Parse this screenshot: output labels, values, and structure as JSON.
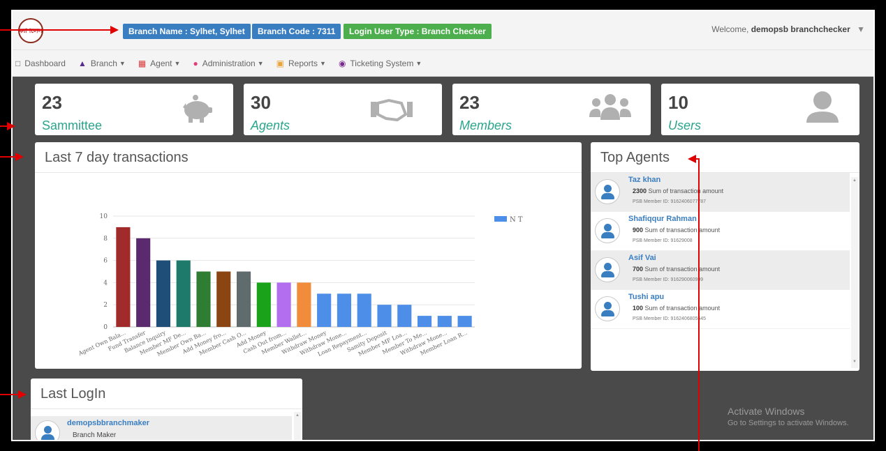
{
  "header": {
    "logo_text": "ক্যাশলেস",
    "badges": {
      "branch_name": "Branch Name : Sylhet, Sylhet",
      "branch_code": "Branch Code : 7311",
      "user_type": "Login User Type : Branch Checker"
    },
    "welcome_prefix": "Welcome,",
    "welcome_user": "demopsb branchchecker"
  },
  "nav": {
    "items": [
      {
        "label": "Dashboard",
        "icon": "dashboard-icon"
      },
      {
        "label": "Branch",
        "icon": "bank-icon"
      },
      {
        "label": "Agent",
        "icon": "cart-icon"
      },
      {
        "label": "Administration",
        "icon": "user-icon"
      },
      {
        "label": "Reports",
        "icon": "report-icon"
      },
      {
        "label": "Ticketing System",
        "icon": "ticket-icon"
      }
    ]
  },
  "stats": [
    {
      "value": "23",
      "label": "Sammittee",
      "icon": "piggy-bank-icon"
    },
    {
      "value": "30",
      "label": "Agents",
      "icon": "handshake-icon"
    },
    {
      "value": "23",
      "label": "Members",
      "icon": "users-icon"
    },
    {
      "value": "10",
      "label": "Users",
      "icon": "user-icon"
    }
  ],
  "transactions_panel": {
    "title": "Last 7 day transactions"
  },
  "chart_data": {
    "type": "bar",
    "legend": [
      "N T"
    ],
    "ylim": [
      0,
      10
    ],
    "yticks": [
      0,
      2,
      4,
      6,
      8,
      10
    ],
    "categories": [
      "Agent Own Bala...",
      "Fund Transfer",
      "Balance Inquiry",
      "Member MF De...",
      "Member Own Ba...",
      "Add Money fro...",
      "Member Cash O...",
      "Add Money",
      "Cash Out from...",
      "Member Wallet...",
      "Withdraw Money",
      "Withdraw Mone...",
      "Loan Repayment...",
      "Samity Deposit",
      "Member MF Loa...",
      "Member To Me...",
      "Withdraw Mone...",
      "Member Loan R..."
    ],
    "values": [
      9,
      8,
      6,
      6,
      5,
      5,
      5,
      4,
      4,
      4,
      3,
      3,
      3,
      2,
      2,
      1,
      1,
      1
    ],
    "colors": [
      "#a12b2b",
      "#5b2a6e",
      "#1f4e79",
      "#1e7a6a",
      "#2e7d32",
      "#8b4513",
      "#5f6b6d",
      "#1aa31a",
      "#b36ef0",
      "#f08c3a",
      "#4d8ee8",
      "#4d8ee8",
      "#4d8ee8",
      "#4d8ee8",
      "#4d8ee8",
      "#4d8ee8",
      "#4d8ee8",
      "#4d8ee8"
    ]
  },
  "top_agents": {
    "title": "Top Agents",
    "amount_suffix": "Sum of transaction amount",
    "items": [
      {
        "name": "Taz khan",
        "amount": "2300",
        "member_id": "PSB Member ID: 9162406077787"
      },
      {
        "name": "Shafiqqur Rahman",
        "amount": "900",
        "member_id": "PSB Member ID: 91629008"
      },
      {
        "name": "Asif Vai",
        "amount": "700",
        "member_id": "PSB Member ID: 916290060999"
      },
      {
        "name": "Tushi apu",
        "amount": "100",
        "member_id": "PSB Member ID: 9162406805645"
      }
    ]
  },
  "last_login": {
    "title": "Last LogIn",
    "items": [
      {
        "name": "demopsbbranchmaker",
        "role": "Branch Maker"
      }
    ]
  },
  "watermark": {
    "title": "Activate Windows",
    "subtitle": "Go to Settings to activate Windows."
  }
}
